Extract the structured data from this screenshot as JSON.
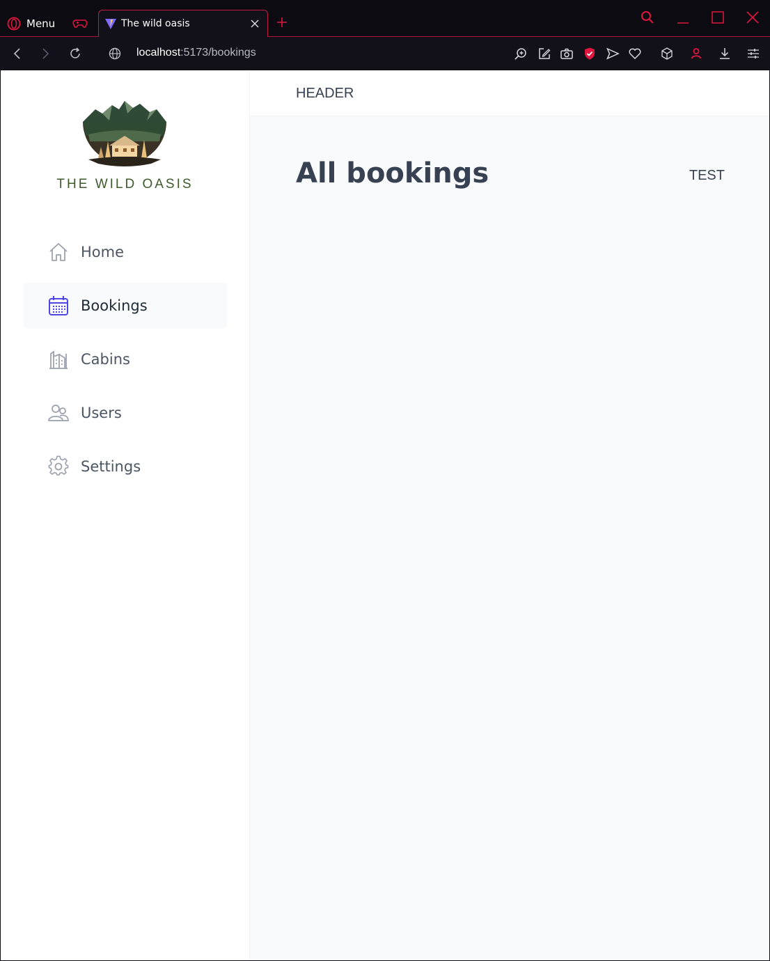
{
  "browser": {
    "menu_label": "Menu",
    "tab_title": "The wild oasis",
    "url_host": "localhost",
    "url_path": ":5173/bookings",
    "accent_color": "#e0163e"
  },
  "app": {
    "brand_name": "THE WILD OASIS",
    "header_text": "HEADER",
    "page_title": "All bookings",
    "test_label": "TEST",
    "nav": [
      {
        "label": "Home",
        "icon": "home-icon"
      },
      {
        "label": "Bookings",
        "icon": "calendar-icon",
        "active": true
      },
      {
        "label": "Cabins",
        "icon": "cabins-icon"
      },
      {
        "label": "Users",
        "icon": "users-icon"
      },
      {
        "label": "Settings",
        "icon": "gear-icon"
      }
    ],
    "active_color": "#4f46e5"
  }
}
